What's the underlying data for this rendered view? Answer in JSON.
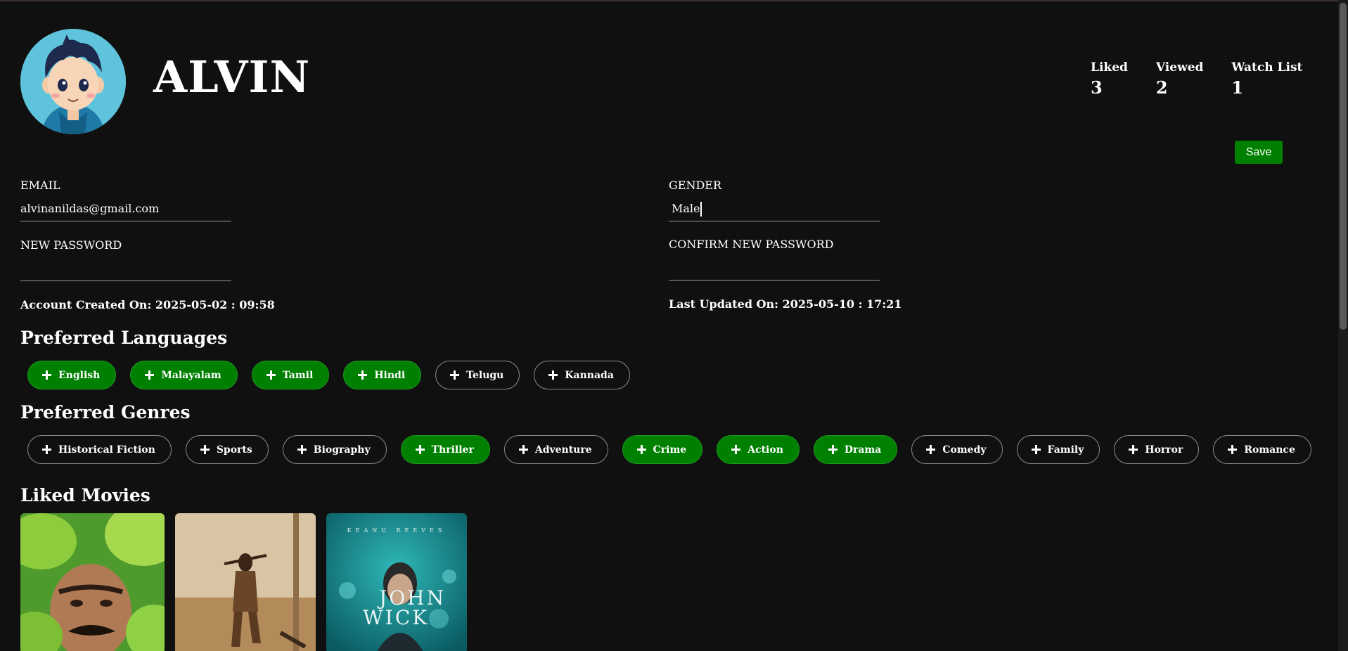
{
  "profile": {
    "username": "ALVIN",
    "stats": [
      {
        "label": "Liked",
        "value": "3"
      },
      {
        "label": "Viewed",
        "value": "2"
      },
      {
        "label": "Watch List",
        "value": "1"
      }
    ],
    "save_label": "Save"
  },
  "form": {
    "email_label": "EMAIL",
    "email_value": "alvinanildas@gmail.com",
    "gender_label": "GENDER",
    "gender_value": "Male",
    "new_password_label": "NEW PASSWORD",
    "confirm_password_label": "CONFIRM NEW PASSWORD",
    "created_text": "Account Created On: 2025-05-02 : 09:58",
    "updated_text": "Last Updated On: 2025-05-10 : 17:21"
  },
  "languages": {
    "title": "Preferred Languages",
    "items": [
      {
        "label": "English",
        "selected": true
      },
      {
        "label": "Malayalam",
        "selected": true
      },
      {
        "label": "Tamil",
        "selected": true
      },
      {
        "label": "Hindi",
        "selected": true
      },
      {
        "label": "Telugu",
        "selected": false
      },
      {
        "label": "Kannada",
        "selected": false
      }
    ]
  },
  "genres": {
    "title": "Preferred Genres",
    "items": [
      {
        "label": "Historical Fiction",
        "selected": false
      },
      {
        "label": "Sports",
        "selected": false
      },
      {
        "label": "Biography",
        "selected": false
      },
      {
        "label": "Thriller",
        "selected": true
      },
      {
        "label": "Adventure",
        "selected": false
      },
      {
        "label": "Crime",
        "selected": true
      },
      {
        "label": "Action",
        "selected": true
      },
      {
        "label": "Drama",
        "selected": true
      },
      {
        "label": "Comedy",
        "selected": false
      },
      {
        "label": "Family",
        "selected": false
      },
      {
        "label": "Horror",
        "selected": false
      },
      {
        "label": "Romance",
        "selected": false
      }
    ]
  },
  "liked_movies": {
    "title": "Liked Movies",
    "poster3_top_text": "KEANU REEVES",
    "poster3_title_line1": "JOHN",
    "poster3_title_line2": "WICK"
  },
  "colors": {
    "background": "#101010",
    "accent_green": "#008000",
    "chip_border": "#8a8a8a"
  },
  "icons": {
    "chip_icon": "plus-icon",
    "select_icon": "chevron-down-icon"
  }
}
